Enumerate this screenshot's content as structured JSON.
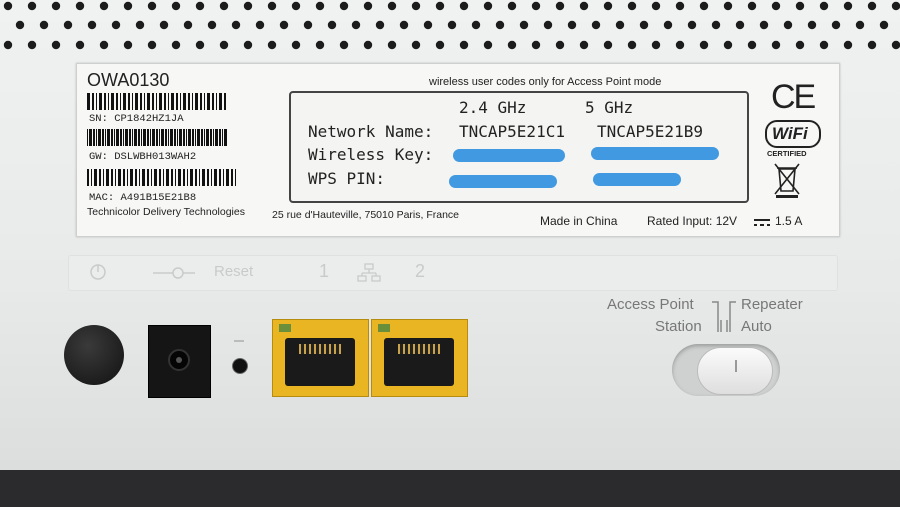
{
  "label": {
    "model": "OWA0130",
    "sn": "SN: CP1842HZ1JA",
    "gw": "GW: DSLWBH013WAH2",
    "mac": "MAC: A491B15E21B8",
    "company": "Technicolor Delivery Technologies",
    "address": "25 rue d'Hauteville, 75010 Paris, France",
    "note": "wireless user codes only for Access Point mode",
    "band_24": "2.4 GHz",
    "band_5": "5 GHz",
    "network_name_label": "Network Name:",
    "ssid_24": "TNCAP5E21C1",
    "ssid_5": "TNCAP5E21B9",
    "wireless_key_label": "Wireless Key:",
    "wps_pin_label": "WPS PIN:",
    "made_in": "Made in China",
    "rated_input": "Rated Input: 12V",
    "current": "1.5 A",
    "ce_mark": "CE",
    "wifi_logo": "WiFi",
    "wifi_certified": "CERTIFIED"
  },
  "panel": {
    "reset_label": "Reset",
    "port_1": "1",
    "port_2": "2",
    "switch_access_point": "Access Point",
    "switch_repeater": "Repeater",
    "switch_station": "Station",
    "switch_auto": "Auto"
  },
  "colors": {
    "port_yellow": "#e9b522",
    "redaction_blue": "#2e8fe0"
  },
  "icons": [
    "power-icon",
    "reset-icon",
    "network-icon",
    "weee-bin-icon",
    "dc-symbol-icon"
  ]
}
